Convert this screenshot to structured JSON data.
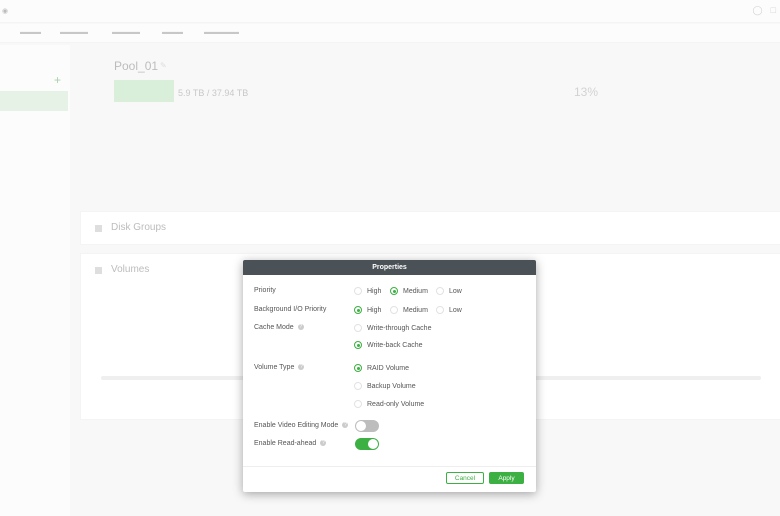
{
  "dialog": {
    "title": "Properties",
    "priority": {
      "label": "Priority",
      "options": [
        "High",
        "Medium",
        "Low"
      ],
      "selected": "Medium"
    },
    "bg_io_priority": {
      "label": "Background I/O Priority",
      "options": [
        "High",
        "Medium",
        "Low"
      ],
      "selected": "High"
    },
    "cache_mode": {
      "label": "Cache Mode",
      "options": [
        "Write-through Cache",
        "Write-back Cache"
      ],
      "selected": "Write-back Cache"
    },
    "volume_type": {
      "label": "Volume Type",
      "options": [
        "RAID Volume",
        "Backup Volume",
        "Read-only Volume"
      ],
      "selected": "RAID Volume"
    },
    "video_editing": {
      "label": "Enable Video Editing Mode",
      "enabled": false
    },
    "read_ahead": {
      "label": "Enable Read-ahead",
      "enabled": true
    },
    "cancel_label": "Cancel",
    "apply_label": "Apply"
  },
  "background": {
    "pool_name": "Pool_01",
    "capacity": "5.9 TB / 37.94 TB",
    "usage_percent": "13%",
    "disk_groups_title": "Disk Groups",
    "volumes_title": "Volumes"
  },
  "colors": {
    "accent": "#3cb043",
    "header": "#4a5157"
  }
}
